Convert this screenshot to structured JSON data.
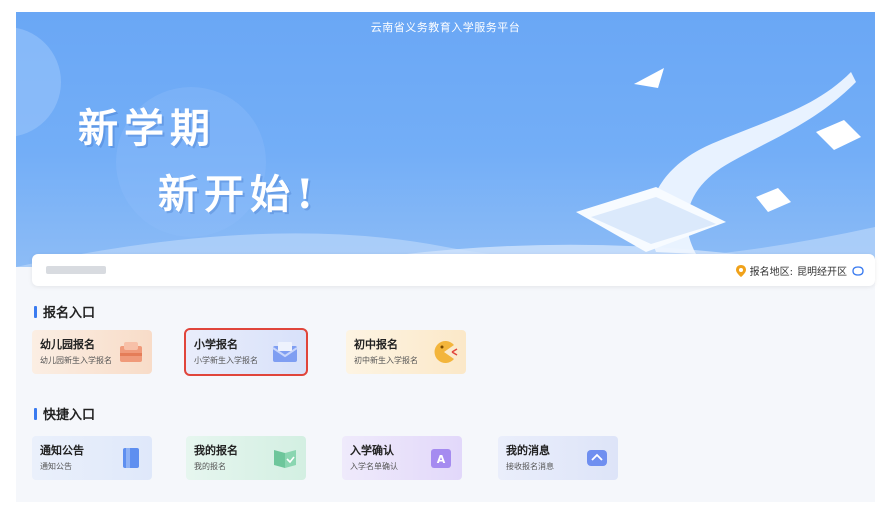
{
  "header": {
    "title": "云南省义务教育入学服务平台"
  },
  "banner": {
    "line1": "新学期",
    "line2": "新开始!"
  },
  "search": {
    "region_label": "报名地区:",
    "region_value": "昆明经开区"
  },
  "sections": {
    "enroll": {
      "title": "报名入口",
      "cards": [
        {
          "title": "幼儿园报名",
          "subtitle": "幼儿园新生入学报名",
          "icon": "bag-icon"
        },
        {
          "title": "小学报名",
          "subtitle": "小学新生入学报名",
          "icon": "envelope-icon"
        },
        {
          "title": "初中报名",
          "subtitle": "初中新生入学报名",
          "icon": "pacman-icon"
        }
      ]
    },
    "quick": {
      "title": "快捷入口",
      "cards": [
        {
          "title": "通知公告",
          "subtitle": "通知公告",
          "icon": "book-icon"
        },
        {
          "title": "我的报名",
          "subtitle": "我的报名",
          "icon": "check-book-icon"
        },
        {
          "title": "入学确认",
          "subtitle": "入学名单确认",
          "icon": "letter-a-icon"
        },
        {
          "title": "我的消息",
          "subtitle": "接收报名消息",
          "icon": "message-icon"
        }
      ]
    }
  },
  "colors": {
    "accent": "#3a7bf0",
    "selected_outline": "#e0453b"
  }
}
